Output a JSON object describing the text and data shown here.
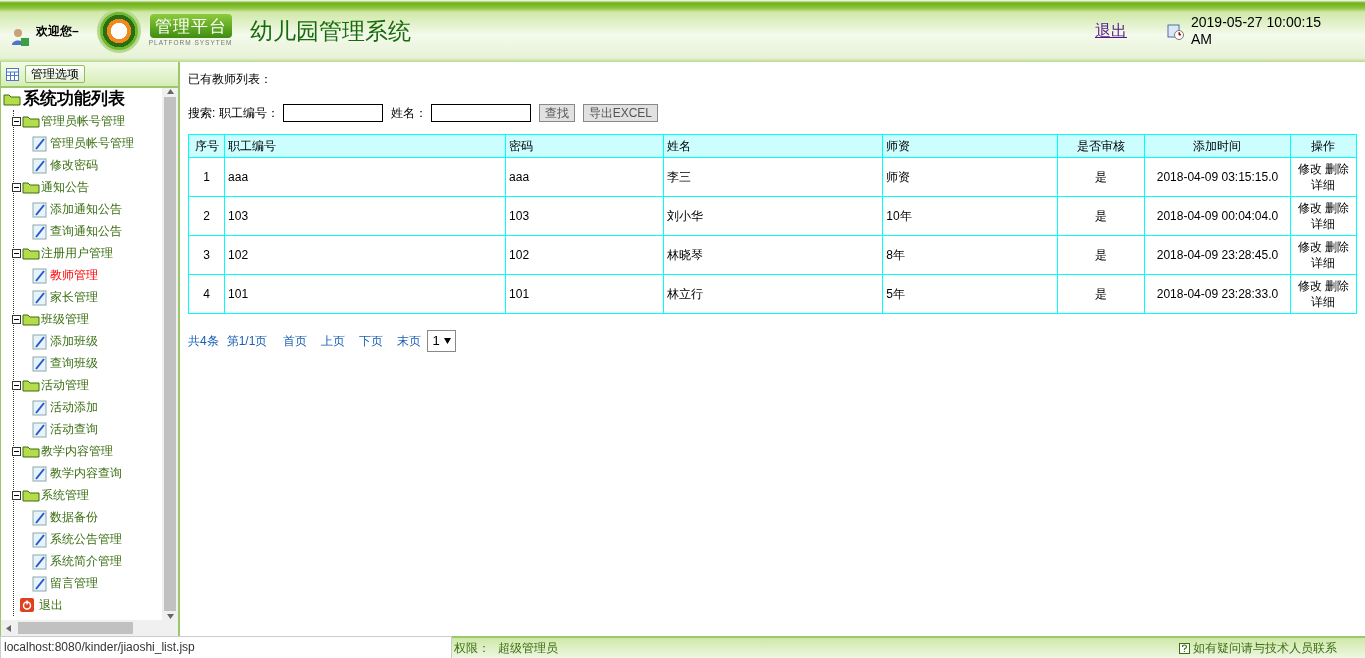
{
  "header": {
    "welcome": "欢迎您–",
    "logo_badge": "管理平台",
    "logo_sub": "PLATFORM SYSYTEM",
    "title": "幼儿园管理系统",
    "logout": "退出",
    "datetime": "2019-05-27 10:00:15 AM"
  },
  "sidebar": {
    "tab": "管理选项",
    "root": "系统功能列表",
    "groups": [
      {
        "label": "管理员帐号管理",
        "expanded": true,
        "children": [
          {
            "label": "管理员帐号管理",
            "selected": false
          },
          {
            "label": "修改密码",
            "selected": false
          }
        ]
      },
      {
        "label": "通知公告",
        "expanded": true,
        "children": [
          {
            "label": "添加通知公告",
            "selected": false
          },
          {
            "label": "查询通知公告",
            "selected": false
          }
        ]
      },
      {
        "label": "注册用户管理",
        "expanded": true,
        "children": [
          {
            "label": "教师管理",
            "selected": true
          },
          {
            "label": "家长管理",
            "selected": false
          }
        ]
      },
      {
        "label": "班级管理",
        "expanded": true,
        "children": [
          {
            "label": "添加班级",
            "selected": false
          },
          {
            "label": "查询班级",
            "selected": false
          }
        ]
      },
      {
        "label": "活动管理",
        "expanded": true,
        "children": [
          {
            "label": "活动添加",
            "selected": false
          },
          {
            "label": "活动查询",
            "selected": false
          }
        ]
      },
      {
        "label": "教学内容管理",
        "expanded": true,
        "children": [
          {
            "label": "教学内容查询",
            "selected": false
          }
        ]
      },
      {
        "label": "系统管理",
        "expanded": true,
        "children": [
          {
            "label": "数据备份",
            "selected": false
          },
          {
            "label": "系统公告管理",
            "selected": false
          },
          {
            "label": "系统简介管理",
            "selected": false
          },
          {
            "label": "留言管理",
            "selected": false
          }
        ]
      }
    ],
    "exit": "退出"
  },
  "main": {
    "heading": "已有教师列表：",
    "search": {
      "label": "搜索: 职工编号：",
      "name_label": "姓名：",
      "buttons": [
        "查找",
        "导出EXCEL"
      ]
    },
    "table": {
      "columns": [
        "序号",
        "职工编号",
        "密码",
        "姓名",
        "师资",
        "是否审核",
        "添加时间",
        "操作"
      ],
      "rows": [
        {
          "cells": [
            "1",
            "aaa",
            "aaa",
            "李三",
            "师资",
            "是",
            "2018-04-09 03:15:15.0"
          ],
          "actions": [
            "修改",
            "删除",
            "详细"
          ]
        },
        {
          "cells": [
            "2",
            "103",
            "103",
            "刘小华",
            "10年",
            "是",
            "2018-04-09 00:04:04.0"
          ],
          "actions": [
            "修改",
            "删除",
            "详细"
          ]
        },
        {
          "cells": [
            "3",
            "102",
            "102",
            "林晓琴",
            "8年",
            "是",
            "2018-04-09 23:28:45.0"
          ],
          "actions": [
            "修改",
            "删除",
            "详细"
          ]
        },
        {
          "cells": [
            "4",
            "101",
            "101",
            "林立行",
            "5年",
            "是",
            "2018-04-09 23:28:33.0"
          ],
          "actions": [
            "修改",
            "删除",
            "详细"
          ]
        }
      ]
    },
    "pager": {
      "total": "共4条",
      "page": "第1/1页",
      "links": [
        "首页",
        "上页",
        "下页",
        "末页"
      ],
      "select": "1"
    }
  },
  "status_bar": {
    "role_label": "权限：",
    "role": "超级管理员",
    "help": "如有疑问请与技术人员联系"
  },
  "browser_tooltip": "localhost:8080/kinder/jiaoshi_list.jsp"
}
